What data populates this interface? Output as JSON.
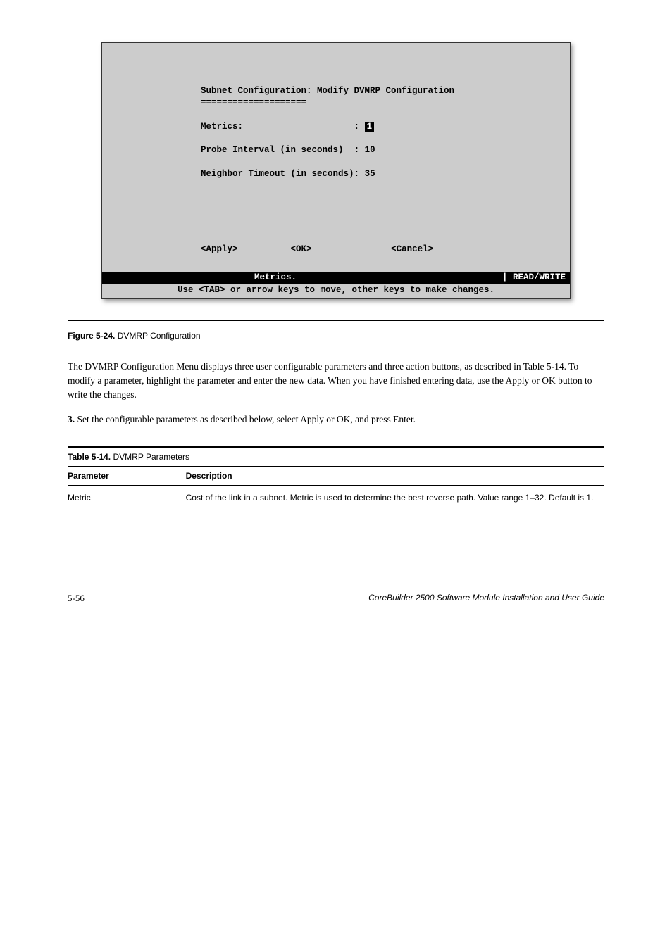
{
  "terminal": {
    "title": "Subnet Configuration: Modify DVMRP Configuration",
    "divider": "====================",
    "rows": {
      "metrics_label": "Metrics:",
      "metrics_colon": ":",
      "metrics_value": "1",
      "probe_label": "Probe Interval (in seconds)",
      "probe_colon": ":",
      "probe_value": "10",
      "neighbor_label": "Neighbor Timeout (in seconds):",
      "neighbor_value": "35"
    },
    "buttons": {
      "apply": "<Apply>",
      "ok": "<OK>",
      "cancel": "<Cancel>"
    },
    "status": {
      "left": "Metrics.",
      "right": "| READ/WRITE"
    },
    "hint": "Use <TAB> or arrow keys to move, other keys to make changes."
  },
  "figure": {
    "label": "Figure 5-24.",
    "title": "DVMRP Configuration"
  },
  "body": {
    "p1": "The DVMRP Configuration Menu displays three user configurable parameters and three action buttons, as described in Table 5-14. To modify a parameter, highlight the parameter and enter the new data. When you have finished entering data, use the Apply or OK button to write the changes.",
    "p2_prefix": "3.",
    "p2": "Set the configurable parameters as described below, select Apply or OK, and press Enter."
  },
  "table": {
    "caption_label": "Table 5-14.",
    "caption_title": "DVMRP Parameters",
    "headers": {
      "param": "Parameter",
      "desc": "Description"
    },
    "rows": [
      {
        "param": "Metric",
        "desc": "Cost of the link in a subnet. Metric is used to determine the best reverse path. Value range 1–32. Default is 1."
      }
    ]
  },
  "footer": {
    "page": "5-56",
    "title": "CoreBuilder 2500 Software Module Installation and User Guide"
  }
}
